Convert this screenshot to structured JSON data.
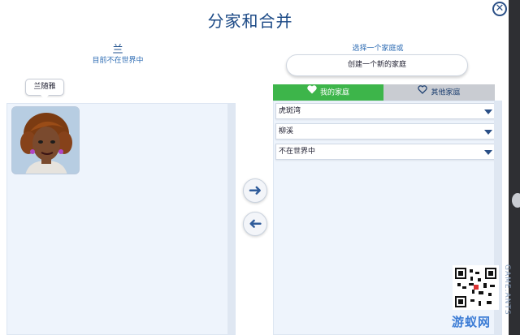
{
  "dialog": {
    "title": "分家和合并",
    "close_glyph": "✕"
  },
  "left": {
    "household_name": "兰",
    "household_status": "目前不在世界中",
    "sims": [
      {
        "name": "兰随雅"
      }
    ]
  },
  "transfer": {
    "move_right_icon": "arrow-right-icon",
    "move_left_icon": "arrow-left-icon"
  },
  "right": {
    "select_label": "选择一个家庭或",
    "create_button": "创建一个新的家庭",
    "tabs": [
      {
        "label": "我的家庭",
        "icon": "heart-filled-icon",
        "active": true,
        "color": "#3db54a"
      },
      {
        "label": "其他家庭",
        "icon": "heart-outline-icon",
        "active": false,
        "color": "#c9ccd2"
      }
    ],
    "households": [
      {
        "label": "虎斑湾"
      },
      {
        "label": "柳溪"
      },
      {
        "label": "不在世界中"
      }
    ]
  },
  "watermark": {
    "site_cn": "游蚁网",
    "site_en": "GAME.ANTS"
  }
}
